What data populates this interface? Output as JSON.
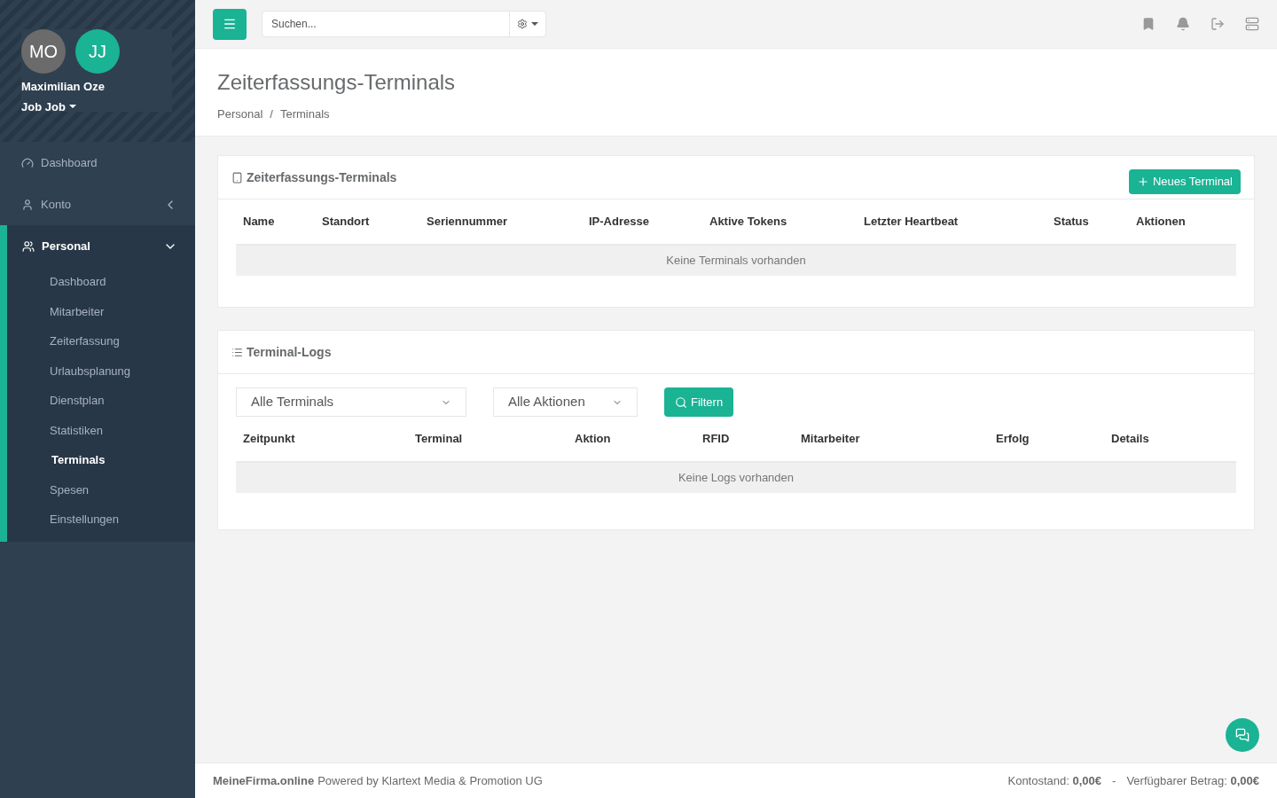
{
  "user": {
    "avatars": [
      {
        "initials": "MO",
        "color": "#6b6b6b"
      },
      {
        "initials": "JJ",
        "color": "#1ab394"
      }
    ],
    "name": "Maximilian Oze",
    "role": "Job Job"
  },
  "sidebar": {
    "items": [
      {
        "label": "Dashboard",
        "selected": false
      },
      {
        "label": "Konto",
        "selected": false,
        "expanded": false
      },
      {
        "label": "Personal",
        "selected": true,
        "expanded": true,
        "children": [
          {
            "label": "Dashboard",
            "selected": false
          },
          {
            "label": "Mitarbeiter",
            "selected": false
          },
          {
            "label": "Zeiterfassung",
            "selected": false
          },
          {
            "label": "Urlaubsplanung",
            "selected": false
          },
          {
            "label": "Dienstplan",
            "selected": false
          },
          {
            "label": "Statistiken",
            "selected": false
          },
          {
            "label": "Terminals",
            "selected": true
          },
          {
            "label": "Spesen",
            "selected": false
          },
          {
            "label": "Einstellungen",
            "selected": false
          }
        ]
      }
    ]
  },
  "topbar": {
    "search": {
      "placeholder": "Suchen..."
    }
  },
  "page": {
    "title": "Zeiterfassungs-Terminals",
    "breadcrumb": [
      "Personal",
      "Terminals"
    ],
    "breadcrumb_separator": "/"
  },
  "terminals": {
    "title": "Zeiterfassungs-Terminals",
    "new_button": "Neues Terminal",
    "columns": [
      "Name",
      "Standort",
      "Seriennummer",
      "IP-Adresse",
      "Aktive Tokens",
      "Letzter Heartbeat",
      "Status",
      "Aktionen"
    ],
    "empty": "Keine Terminals vorhanden"
  },
  "logs": {
    "title": "Terminal-Logs",
    "filters": [
      {
        "value": "Alle Terminals"
      },
      {
        "value": "Alle Aktionen"
      }
    ],
    "filter_button": "Filtern",
    "columns": [
      "Zeitpunkt",
      "Terminal",
      "Aktion",
      "RFID",
      "Mitarbeiter",
      "Erfolg",
      "Details"
    ],
    "empty": "Keine Logs vorhanden"
  },
  "footer": {
    "brand": "MeineFirma.online",
    "credit": "Powered by Klartext Media & Promotion UG",
    "balance": "Kontostand: **0,00€**",
    "separator": "-",
    "available": "Verfügbarer Betrag: **0,00€**"
  }
}
